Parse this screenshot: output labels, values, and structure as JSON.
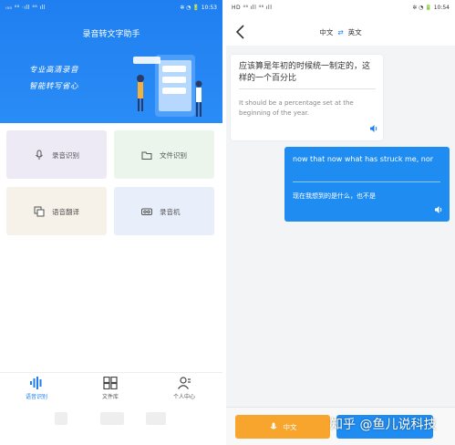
{
  "left_screen": {
    "status_bar": {
      "signal": "ᵢ₀₀ ⁴⁶ ⋅ıll ⁴⁶ ıll",
      "icons": "✲ ◔ 🔋",
      "time": "10:53"
    },
    "app_title": "录音转文字助手",
    "slogans": [
      "专业高清录音",
      "智能转写省心"
    ],
    "cards": [
      {
        "label": "录音识别",
        "icon": "microphone-icon"
      },
      {
        "label": "文件识别",
        "icon": "folder-icon"
      },
      {
        "label": "语音翻译",
        "icon": "translate-icon"
      },
      {
        "label": "录音机",
        "icon": "recorder-icon"
      }
    ],
    "nav": [
      {
        "label": "语音识别",
        "icon": "waveform-icon",
        "active": true
      },
      {
        "label": "文件库",
        "icon": "grid-icon",
        "active": false
      },
      {
        "label": "个人中心",
        "icon": "user-icon",
        "active": false
      }
    ]
  },
  "right_screen": {
    "status_bar": {
      "signal": "HD ⁴⁶ ıll ⁴⁶ ıll",
      "icons": "✲ ◔ 🔋",
      "time": "10:54"
    },
    "lang_from": "中文",
    "lang_swap_icon": "⇄",
    "lang_to": "英文",
    "message_left": {
      "source": "应该算是年初的时候统一制定的，这样的一个百分比",
      "translation": "It should be a percentage set at the beginning of the year."
    },
    "message_right": {
      "source": "now that now what has struck me, nor",
      "translation": "现在我想到的是什么，也不是"
    },
    "btn_chinese": "中文",
    "watermark": "知乎 @鱼儿说科技"
  },
  "colors": {
    "primary": "#1f7ff0",
    "orange": "#f7a52d"
  }
}
